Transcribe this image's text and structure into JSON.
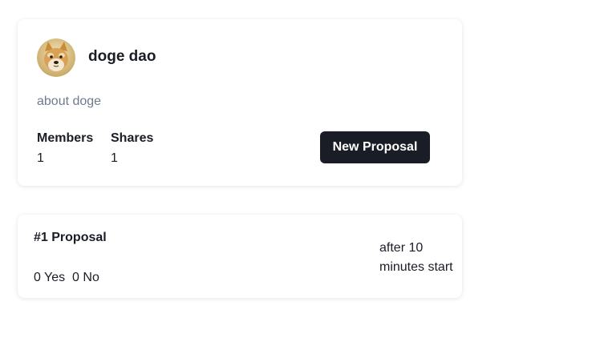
{
  "dao": {
    "avatar_icon": "doge-avatar-icon",
    "name": "doge dao",
    "description": "about doge",
    "members_label": "Members",
    "members_value": "1",
    "shares_label": "Shares",
    "shares_value": "1",
    "new_proposal_label": "New Proposal"
  },
  "proposals": [
    {
      "title": "#1 Proposal",
      "yes_label": "0 Yes",
      "no_label": "0 No",
      "status": "after 10 minutes start"
    }
  ],
  "colors": {
    "button_bg": "#1a1d26",
    "muted_text": "#6f7b8c"
  }
}
